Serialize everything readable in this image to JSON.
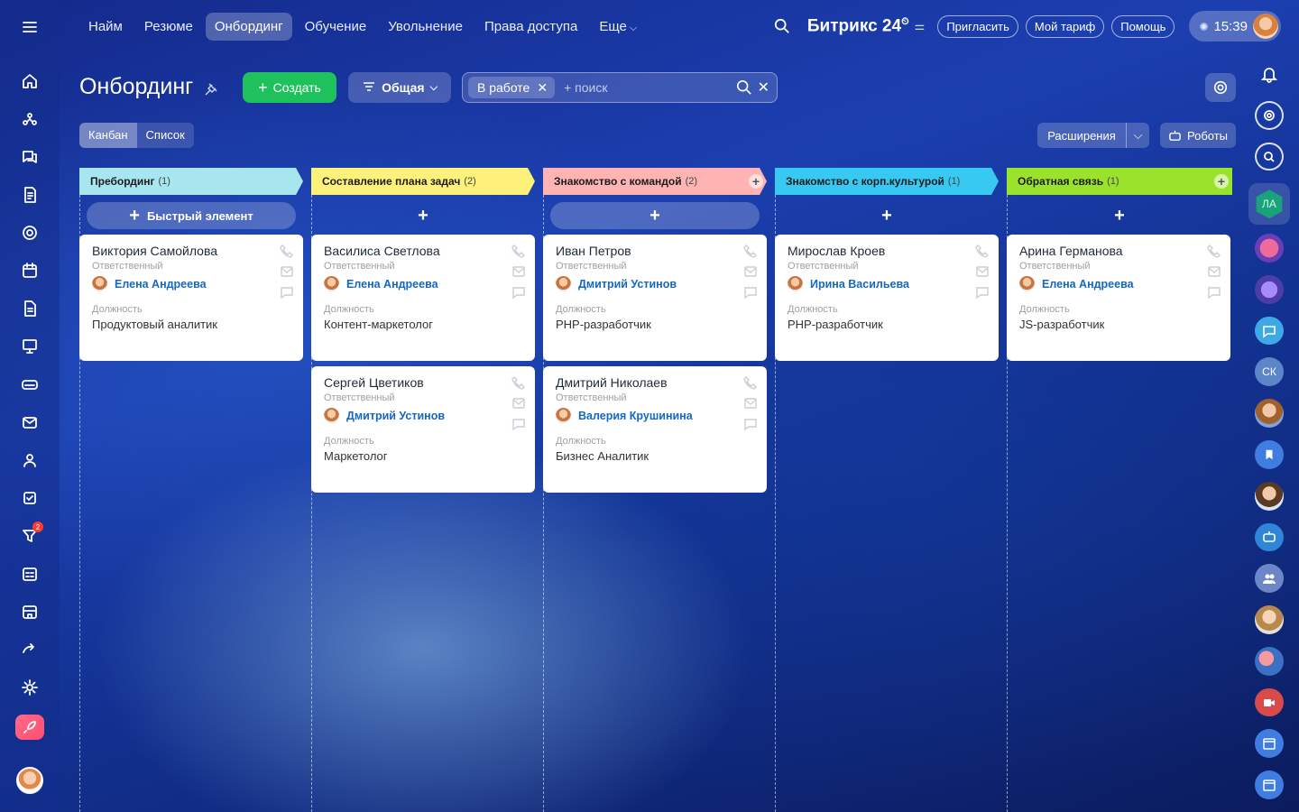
{
  "topnav": {
    "items": [
      "Найм",
      "Резюме",
      "Онбординг",
      "Обучение",
      "Увольнение",
      "Права доступа",
      "Еще"
    ],
    "active_index": 2,
    "brand": "Битрикс 24",
    "invite": "Пригласить",
    "tariff": "Мой тариф",
    "help": "Помощь",
    "time": "15:39"
  },
  "toolbar": {
    "title": "Онбординг",
    "create": "Создать",
    "filter": "Общая",
    "search_tag": "В работе",
    "search_placeholder": "+ поиск",
    "view_kanban": "Канбан",
    "view_list": "Список",
    "extensions": "Расширения",
    "robots": "Роботы"
  },
  "labels": {
    "responsible": "Ответственный",
    "position": "Должность",
    "quick_add": "Быстрый элемент"
  },
  "columns": [
    {
      "title": "Преборд инг",
      "name": "Пребординг",
      "count": "(1)",
      "color": "#a8e6ef",
      "cards": [
        {
          "name": "Виктория Самойлова",
          "responsible": "Елена Андреева",
          "position": "Продуктовый аналитик"
        }
      ]
    },
    {
      "name": "Составление плана задач",
      "count": "(2)",
      "color": "#fdf17a",
      "cards": [
        {
          "name": "Василиса Светлова",
          "responsible": "Елена Андреева",
          "position": "Контент-маркетолог"
        },
        {
          "name": "Сергей Цветиков",
          "responsible": "Дмитрий Устинов",
          "position": "Маркетолог"
        }
      ]
    },
    {
      "name": "Знакомство с командой",
      "count": "(2)",
      "color": "#ffb3b3",
      "cards": [
        {
          "name": "Иван Петров",
          "responsible": "Дмитрий Устинов",
          "position": "PHP-разработчик"
        },
        {
          "name": "Дмитрий Николаев",
          "responsible": "Валерия Крушинина",
          "position": "Бизнес Аналитик"
        }
      ]
    },
    {
      "name": "Знакомство с корп.культурой",
      "count": "(1)",
      "color": "#38c9f2",
      "cards": [
        {
          "name": "Мирослав Кроев",
          "responsible": "Ирина Васильева",
          "position": "PHP-разработчик"
        }
      ]
    },
    {
      "name": "Обратная связь",
      "count": "(1)",
      "color": "#9be22d",
      "cards": [
        {
          "name": "Арина Германова",
          "responsible": "Елена Андреева",
          "position": "JS-разработчик"
        }
      ]
    }
  ],
  "leftbar": {
    "badge_count": "2"
  },
  "rightbar": {
    "initials_1": "ЛА",
    "initials_2": "СК"
  }
}
